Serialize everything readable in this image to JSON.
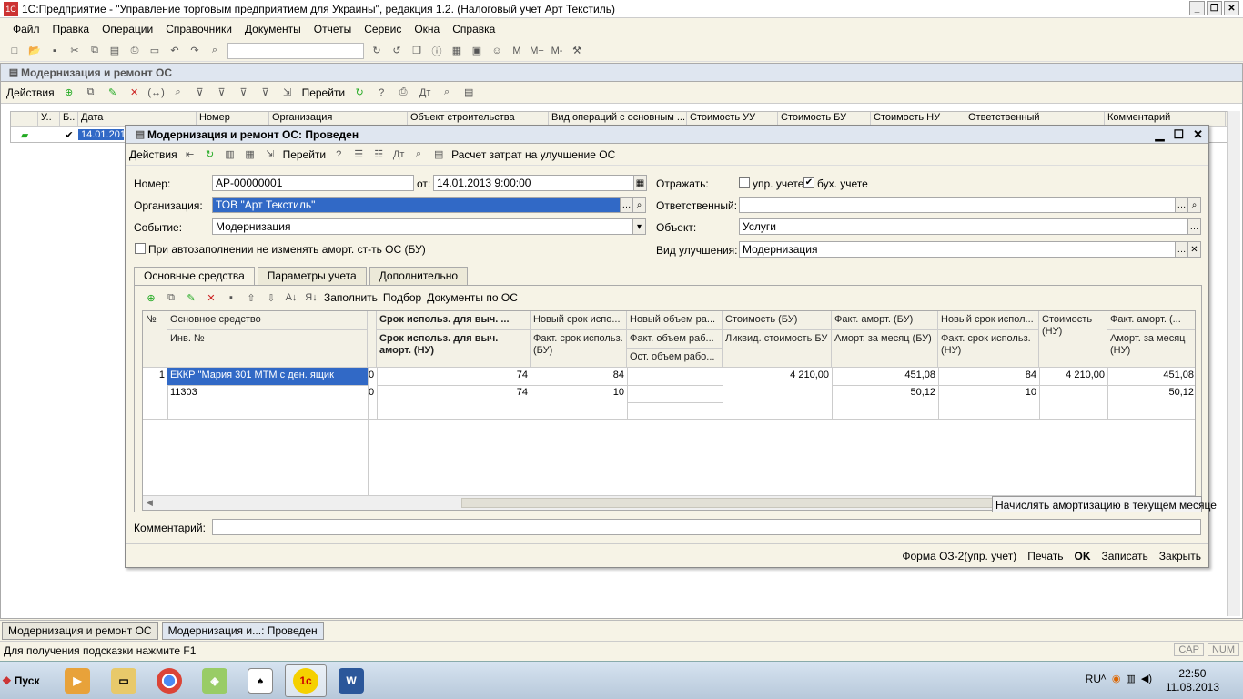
{
  "app": {
    "title": "1С:Предприятие - \"Управление торговым предприятием для Украины\", редакция 1.2. (Налоговый учет Арт Текстиль)"
  },
  "menu": [
    "Файл",
    "Правка",
    "Операции",
    "Справочники",
    "Документы",
    "Отчеты",
    "Сервис",
    "Окна",
    "Справка"
  ],
  "listwin": {
    "title": "Модернизация и ремонт ОС",
    "actions": "Действия",
    "goto": "Перейти",
    "columns": [
      "У..",
      "Б..",
      "Дата",
      "Номер",
      "Организация",
      "Объект строительства",
      "Вид операций с основным ...",
      "Стоимость УУ",
      "Стоимость БУ",
      "Стоимость НУ",
      "Ответственный",
      "Комментарий"
    ],
    "row_date": "14.01.2013"
  },
  "doc": {
    "title": "Модернизация и ремонт ОС: Проведен",
    "actions": "Действия",
    "goto": "Перейти",
    "calc": "Расчет затрат на улучшение ОС",
    "number_label": "Номер:",
    "number": "АР-00000001",
    "from_label": "от:",
    "date": "14.01.2013  9:00:00",
    "org_label": "Организация:",
    "org": "ТОВ \"Арт Текстиль\"",
    "event_label": "Событие:",
    "event": "Модернизация",
    "autofill": "При автозаполнении не изменять аморт. ст-ть ОС (БУ)",
    "reflect_label": "Отражать:",
    "upr": "упр. учете",
    "buh": "бух. учете",
    "resp_label": "Ответственный:",
    "resp": "",
    "obj_label": "Объект:",
    "obj": "Услуги",
    "impr_label": "Вид улучшения:",
    "impr": "Модернизация",
    "tabs": [
      "Основные средства",
      "Параметры учета",
      "Дополнительно"
    ],
    "fill": "Заполнить",
    "pick": "Подбор",
    "docs_os": "Документы по ОС",
    "grid_headers": {
      "n": "№",
      "os": "Основное средство",
      "inv": "Инв. №",
      "srok": "Срок использ. для выч. ...",
      "srok2": "Срок использ. для выч. аморт. (НУ)",
      "new_srok": "Новый срок испо...",
      "fact_srok": "Факт. срок использ. (БУ)",
      "new_vol": "Новый объем ра...",
      "fact_vol": "Факт. объем раб...",
      "ost_vol": "Ост. объем рабо...",
      "cost_bu": "Стоимость (БУ)",
      "liquid": "Ликвид. стоимость БУ",
      "fact_am": "Факт. аморт. (БУ)",
      "am_month": "Аморт. за месяц (БУ)",
      "new_srok2": "Новый срок испол...",
      "fact_srok_nu": "Факт. срок использ. (НУ)",
      "cost_nu": "Стоимость (НУ)",
      "fact_am_nu": "Факт. аморт. (...",
      "am_month_nu": "Аморт. за месяц (НУ)"
    },
    "row": {
      "n": "1",
      "os": "ЕККР \"Мария 301 МТМ с ден. ящик",
      "inv": "11303",
      "zero1": "0",
      "zero2": "0",
      "srok": "74",
      "srok2": "74",
      "new_srok": "84",
      "fact_srok": "10",
      "cost_bu": "4 210,00",
      "fact_am": "451,08",
      "am_month": "50,12",
      "new_srok2": "84",
      "fact_srok_nu": "10",
      "cost_nu": "4 210,00",
      "fact_am_nu": "451,08",
      "am_month_nu": "50,12"
    },
    "charge_am": "Начислять амортизацию в текущем месяце",
    "comment_label": "Комментарий:",
    "comment": "",
    "form": "Форма ОЗ-2(упр. учет)",
    "print": "Печать",
    "ok": "OK",
    "save": "Записать",
    "close": "Закрыть"
  },
  "taskpanel": [
    "Модернизация и ремонт ОС",
    "Модернизация и...: Проведен"
  ],
  "status": {
    "hint": "Для получения подсказки нажмите F1",
    "cap": "CAP",
    "num": "NUM"
  },
  "taskbar": {
    "start": "Пуск",
    "lang": "RU",
    "time": "22:50",
    "date": "11.08.2013"
  },
  "colors": {
    "selection": "#3169c6",
    "titlebg": "#dfe6f0",
    "panel": "#f6f3e6"
  }
}
